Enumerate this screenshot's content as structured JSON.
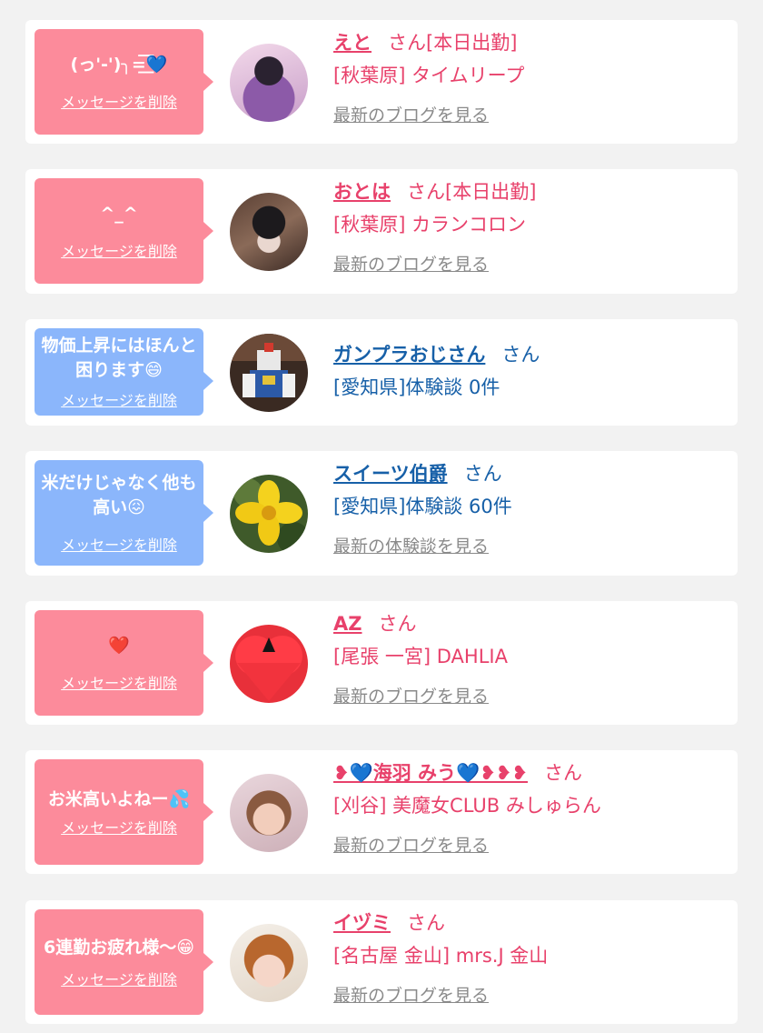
{
  "delete_label": "メッセージを削除",
  "entries": [
    {
      "message": "(っ'-')╮=͟͟͞͞💙",
      "name": "えと",
      "honorific": "さん",
      "status": "[本日出勤]",
      "shop": "[秋葉原] タイムリープ",
      "link": "最新のブログを見る"
    },
    {
      "message": "^_^",
      "name": "おとは",
      "honorific": "さん",
      "status": "[本日出勤]",
      "shop": "[秋葉原] カランコロン",
      "link": "最新のブログを見る"
    },
    {
      "message": "物価上昇にはほんと困ります😄",
      "name": "ガンプラおじさん",
      "honorific": "さん",
      "status": "",
      "shop": "[愛知県]体験談 0件",
      "link": ""
    },
    {
      "message": "米だけじゃなく他も高い😖",
      "name": "スイーツ伯爵",
      "honorific": "さん",
      "status": "",
      "shop": "[愛知県]体験談 60件",
      "link": "最新の体験談を見る"
    },
    {
      "message": "❤️",
      "name": "AZ",
      "honorific": "さん",
      "status": "",
      "shop": "[尾張 一宮] DAHLIA",
      "link": "最新のブログを見る"
    },
    {
      "message": "お米高いよねー💦",
      "name": "❥💙海羽 みう💙❥❥❥",
      "honorific": "さん",
      "status": "",
      "shop": "[刈谷] 美魔女CLUB みしゅらん",
      "link": "最新のブログを見る"
    },
    {
      "message": "6連勤お疲れ様〜😁",
      "name": "イヅミ",
      "honorific": "さん",
      "status": "",
      "shop": "[名古屋 金山] mrs.J 金山",
      "link": "最新のブログを見る"
    }
  ]
}
